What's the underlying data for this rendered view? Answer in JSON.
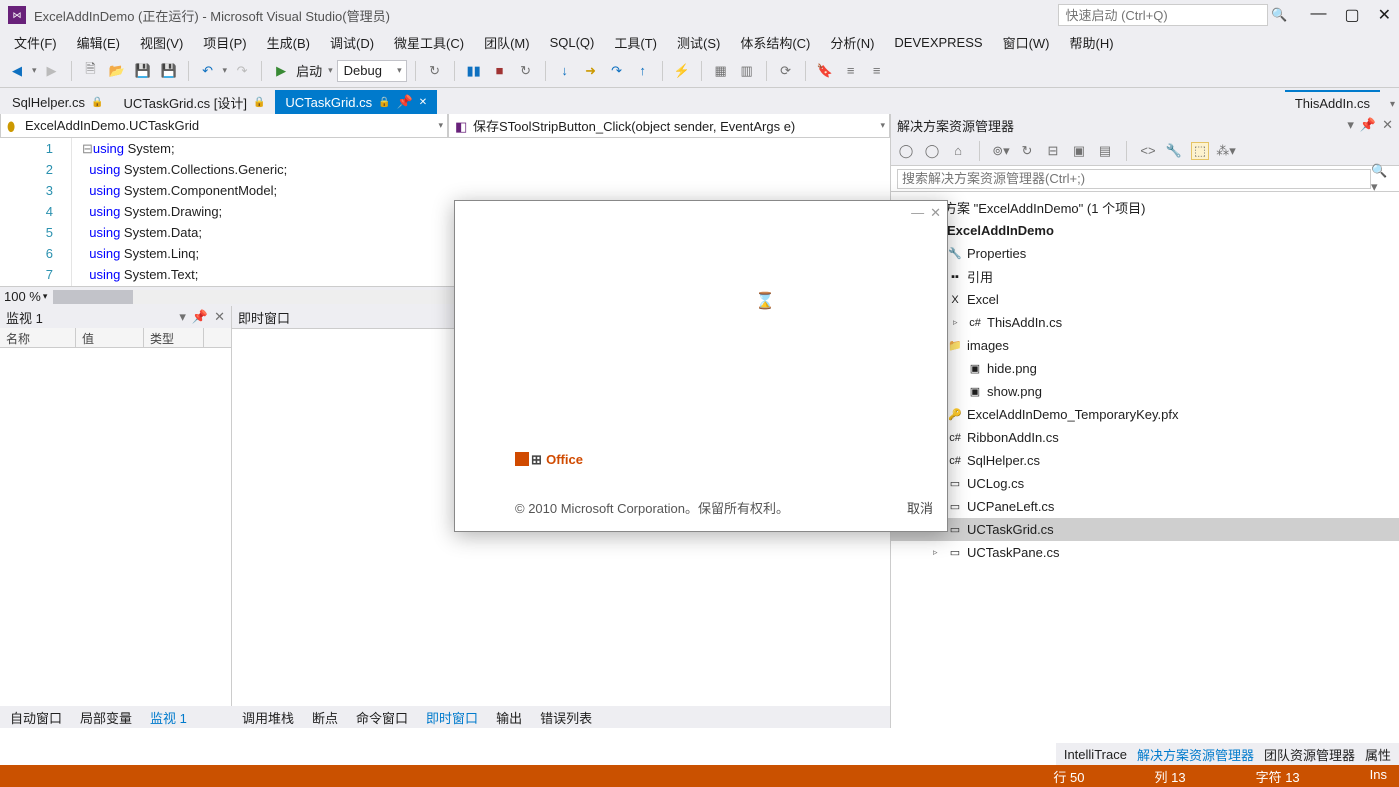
{
  "window": {
    "title": "ExcelAddInDemo (正在运行) - Microsoft Visual Studio(管理员)",
    "quick_launch_placeholder": "快速启动 (Ctrl+Q)"
  },
  "menu": [
    "文件(F)",
    "编辑(E)",
    "视图(V)",
    "项目(P)",
    "生成(B)",
    "调试(D)",
    "微星工具(C)",
    "团队(M)",
    "SQL(Q)",
    "工具(T)",
    "测试(S)",
    "体系结构(C)",
    "分析(N)",
    "DEVEXPRESS",
    "窗口(W)",
    "帮助(H)"
  ],
  "toolbar": {
    "start_label": "启动",
    "config": "Debug"
  },
  "tabs": [
    {
      "label": "SqlHelper.cs",
      "pinned": true
    },
    {
      "label": "UCTaskGrid.cs [设计]",
      "pinned": true
    },
    {
      "label": "UCTaskGrid.cs",
      "pinned": true,
      "active": true,
      "closable": true
    },
    {
      "label": "ThisAddIn.cs",
      "preview": true
    }
  ],
  "nav": {
    "left": "ExcelAddInDemo.UCTaskGrid",
    "right": "保存SToolStripButton_Click(object sender, EventArgs e)"
  },
  "code": {
    "lines": [
      {
        "n": 1,
        "kw": "using",
        "rest": " System;"
      },
      {
        "n": 2,
        "kw": "using",
        "rest": " System.Collections.Generic;"
      },
      {
        "n": 3,
        "kw": "using",
        "rest": " System.ComponentModel;"
      },
      {
        "n": 4,
        "kw": "using",
        "rest": " System.Drawing;"
      },
      {
        "n": 5,
        "kw": "using",
        "rest": " System.Data;"
      },
      {
        "n": 6,
        "kw": "using",
        "rest": " System.Linq;"
      },
      {
        "n": 7,
        "kw": "using",
        "rest": " System.Text;"
      }
    ],
    "zoom": "100 %"
  },
  "watch": {
    "title": "监视 1",
    "cols": [
      "名称",
      "值",
      "类型"
    ]
  },
  "immediate": {
    "title": "即时窗口"
  },
  "bottom_left_tabs": [
    "自动窗口",
    "局部变量",
    "监视 1"
  ],
  "bottom_mid_tabs": [
    "调用堆栈",
    "断点",
    "命令窗口",
    "即时窗口",
    "输出",
    "错误列表"
  ],
  "bottom_right_tabs": [
    "IntelliTrace",
    "解决方案资源管理器",
    "团队资源管理器",
    "属性"
  ],
  "solution": {
    "title": "解决方案资源管理器",
    "search_placeholder": "搜索解决方案资源管理器(Ctrl+;)",
    "root": "决方案 \"ExcelAddInDemo\" (1 个项目)",
    "project": "ExcelAddInDemo",
    "items": [
      {
        "label": "Properties",
        "icon": "🔧",
        "ind": 2
      },
      {
        "label": "引用",
        "icon": "▪▪",
        "ind": 2
      },
      {
        "label": "Excel",
        "icon": "X",
        "ind": 2,
        "arrow": "▿"
      },
      {
        "label": "ThisAddIn.cs",
        "icon": "c#",
        "ind": 3,
        "arrow": "▹"
      },
      {
        "label": "images",
        "icon": "📁",
        "ind": 2
      },
      {
        "label": "hide.png",
        "icon": "▣",
        "ind": 3
      },
      {
        "label": "show.png",
        "icon": "▣",
        "ind": 3
      },
      {
        "label": "ExcelAddInDemo_TemporaryKey.pfx",
        "icon": "🔑",
        "ind": 2
      },
      {
        "label": "RibbonAddIn.cs",
        "icon": "c#",
        "ind": 2
      },
      {
        "label": "SqlHelper.cs",
        "icon": "c#",
        "ind": 2
      },
      {
        "label": "UCLog.cs",
        "icon": "▭",
        "ind": 2
      },
      {
        "label": "UCPaneLeft.cs",
        "icon": "▭",
        "ind": 2
      },
      {
        "label": "UCTaskGrid.cs",
        "icon": "▭",
        "ind": 2,
        "arrow": "▹",
        "sel": true
      },
      {
        "label": "UCTaskPane.cs",
        "icon": "▭",
        "ind": 2,
        "arrow": "▹"
      }
    ]
  },
  "office_dialog": {
    "brand": "Office",
    "copyright": "© 2010 Microsoft Corporation。保留所有权利。",
    "cancel": "取消",
    "wait": "⌛"
  },
  "status": {
    "line": "行 50",
    "col": "列 13",
    "char": "字符 13",
    "mode": "Ins"
  }
}
